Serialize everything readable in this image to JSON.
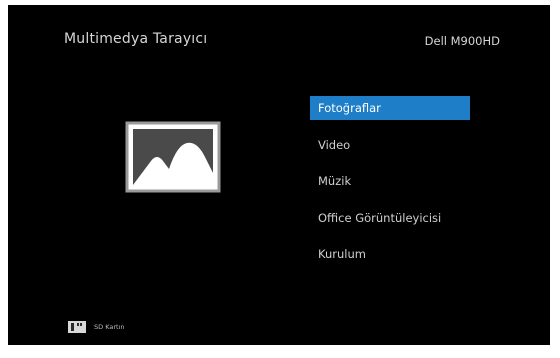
{
  "header": {
    "title": "Multimedya Tarayıcı",
    "device": "Dell M900HD"
  },
  "preview": {
    "icon": "picture-icon"
  },
  "menu": {
    "items": [
      {
        "label": "Fotoğraflar",
        "selected": true
      },
      {
        "label": "Video",
        "selected": false
      },
      {
        "label": "Müzik",
        "selected": false
      },
      {
        "label": "Office Görüntüleyicisi",
        "selected": false
      },
      {
        "label": "Kurulum",
        "selected": false
      }
    ]
  },
  "storage": {
    "icon": "sd-card-icon",
    "label": "SD Kartın"
  },
  "colors": {
    "background": "#000000",
    "accent": "#1e7ec8",
    "text": "#d6d6d6"
  }
}
